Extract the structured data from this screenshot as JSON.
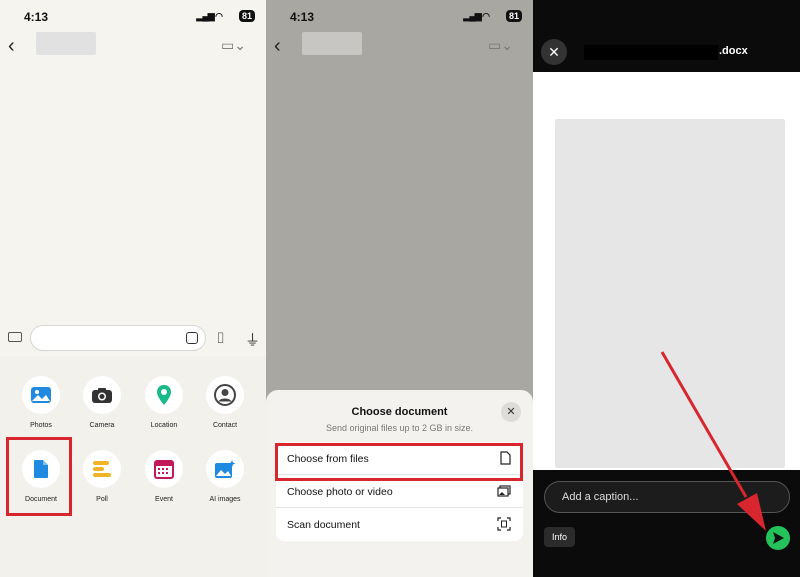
{
  "status": {
    "time": "4:13",
    "battery": "81"
  },
  "panel1": {
    "attachments": [
      {
        "label": "Photos"
      },
      {
        "label": "Camera"
      },
      {
        "label": "Location"
      },
      {
        "label": "Contact"
      },
      {
        "label": "Document"
      },
      {
        "label": "Poll"
      },
      {
        "label": "Event"
      },
      {
        "label": "AI images"
      }
    ],
    "highlight_color": "#d7262e"
  },
  "panel2": {
    "title": "Choose document",
    "subtitle": "Send original files up to 2 GB in size.",
    "options": [
      {
        "label": "Choose from files"
      },
      {
        "label": "Choose photo or video"
      },
      {
        "label": "Scan document"
      }
    ]
  },
  "panel3": {
    "filename": ".docx",
    "caption_placeholder": "Add a caption...",
    "info": "Info",
    "send_color": "#24c25b",
    "arrow_color": "#d7262e"
  }
}
